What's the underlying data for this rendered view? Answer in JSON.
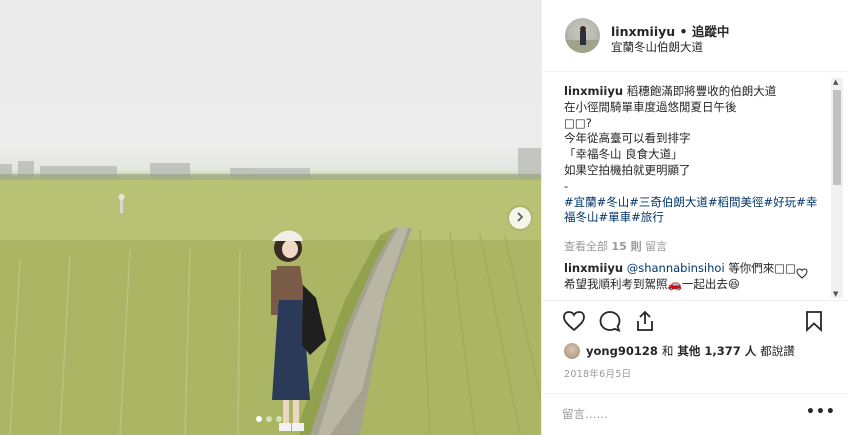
{
  "post": {
    "username": "linxmiiyu",
    "follow_state": "• 追蹤中",
    "location": "宜蘭冬山伯朗大道"
  },
  "caption": {
    "user": "linxmiiyu",
    "lines": [
      "稻穗飽滿即將豐收的伯朗大道",
      "在小徑間騎單車度過悠閒夏日午後",
      "□□?",
      "今年從高臺可以看到排字",
      "「幸福冬山 良食大道」",
      "如果空拍機拍就更明顯了",
      "-"
    ],
    "hashtags": "#宜蘭#冬山#三奇伯朗大道#稻間美徑#好玩#幸福冬山#單車#旅行"
  },
  "view_all": {
    "prefix": "查看全部",
    "count": "15 則",
    "suffix": "留言"
  },
  "reply": {
    "user": "linxmiiyu",
    "mention": "@shannabinsihoi",
    "text": "等你們來□□希望我順利考到駕照🚗一起出去😆"
  },
  "likes": {
    "user": "yong90128",
    "and": "和",
    "others": "其他 1,377 人",
    "suffix": "都說讚"
  },
  "date": "2018年6月5日",
  "comment_input": {
    "placeholder": "留言……"
  },
  "more_label": "•••",
  "icons": {
    "heart": "heart-icon",
    "comment": "comment-icon",
    "share": "share-icon",
    "bookmark": "bookmark-icon",
    "next": "chevron-right-icon"
  }
}
